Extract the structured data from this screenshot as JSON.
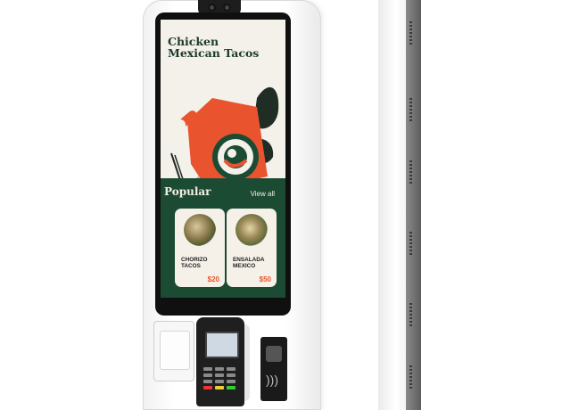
{
  "screen": {
    "title": "Chicken\nMexican Tacos",
    "section_label": "Popular",
    "view_all_label": "View all",
    "items": [
      {
        "name": "CHORIZO\nTACOS",
        "price": "$20"
      },
      {
        "name": "ENSALADA\nMEXICO",
        "price": "$50"
      }
    ]
  },
  "colors": {
    "accent": "#e9542e",
    "brand_green": "#1c4b34",
    "cream": "#f4f0ea"
  },
  "icons": [
    "camera-icon",
    "nfc-icon",
    "card-reader-icon"
  ]
}
